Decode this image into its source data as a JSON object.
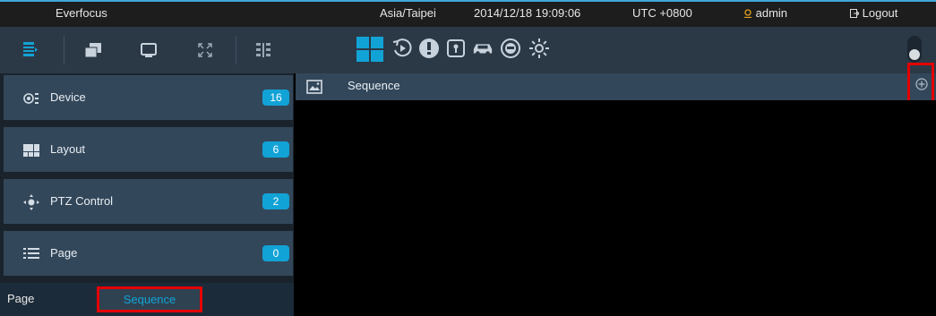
{
  "topbar": {
    "brand": "Everfocus",
    "timezone": "Asia/Taipei",
    "datetime": "2014/12/18 19:09:06",
    "utc": "UTC +0800",
    "user": "admin",
    "logout": "Logout"
  },
  "toolbar": {
    "left_icons": [
      "list-view-icon",
      "windows-icon",
      "monitor-icon",
      "fullscreen-icon",
      "grid-split-icon"
    ],
    "center_icons": [
      "layout-grid-icon",
      "playback-icon",
      "alert-icon",
      "door-icon",
      "car-icon",
      "lpr-icon",
      "settings-icon"
    ],
    "accent": "#12a3d6"
  },
  "sidebar": {
    "panels": [
      {
        "label": "Device",
        "count": "16",
        "icon": "device-icon"
      },
      {
        "label": "Layout",
        "count": "6",
        "icon": "layout-icon"
      },
      {
        "label": "PTZ Control",
        "count": "2",
        "icon": "ptz-icon"
      },
      {
        "label": "Page",
        "count": "0",
        "icon": "page-list-icon"
      }
    ],
    "tabs": {
      "page": "Page",
      "sequence": "Sequence"
    }
  },
  "main": {
    "header_title": "Sequence",
    "header_icon": "image-icon",
    "add_icon": "add-circle-icon"
  }
}
